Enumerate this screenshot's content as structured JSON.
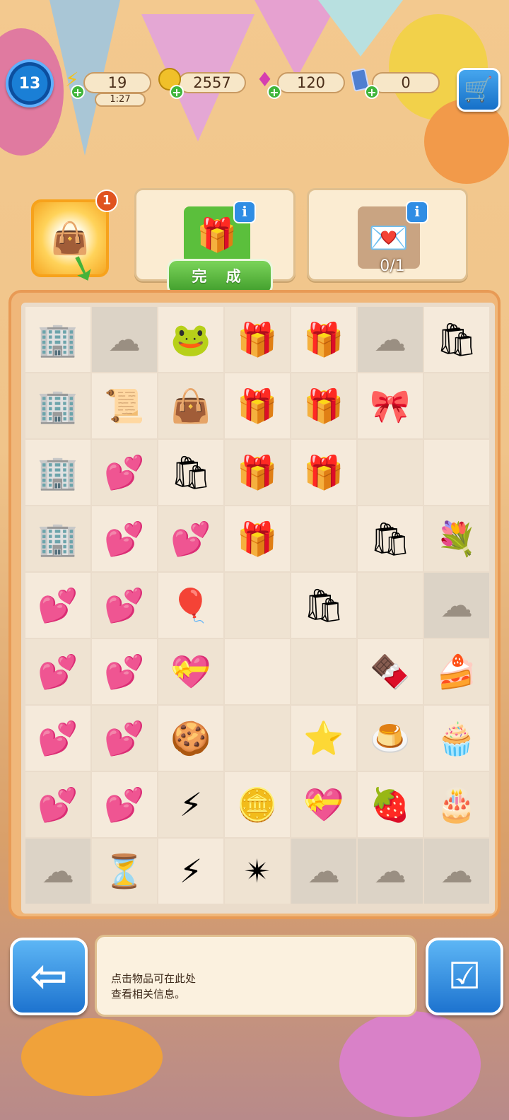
{
  "hud": {
    "level": "13",
    "energy": "19",
    "energy_timer": "1:27",
    "coins": "2557",
    "gems": "120",
    "cards": "0",
    "icons": {
      "energy": "lightning-icon",
      "coins": "coin-icon",
      "gems": "gem-icon",
      "cards": "card-icon",
      "shop": "shopping-cart-icon"
    },
    "add_symbol": "+"
  },
  "orders": {
    "reward_count": "1",
    "done_label": "完 成",
    "progress": "0/1",
    "info_symbol": "i"
  },
  "board": {
    "rows": [
      [
        "🏢",
        "☁",
        "🐸",
        "🎁",
        "🎁",
        "☁",
        "🛍"
      ],
      [
        "🏢",
        "📜",
        "👜",
        "🎁",
        "🎁",
        "🎀",
        ""
      ],
      [
        "🏢",
        "💕",
        "🛍",
        "🎁",
        "🎁",
        "",
        ""
      ],
      [
        "🏢",
        "💕",
        "💕",
        "🎁",
        "",
        "🛍",
        "💐"
      ],
      [
        "💕",
        "💕",
        "🎈",
        "",
        "🛍",
        "",
        "☁"
      ],
      [
        "💕",
        "💕",
        "💝",
        "",
        "",
        "🍫",
        "🍰"
      ],
      [
        "💕",
        "💕",
        "🍪",
        "",
        "⭐",
        "🍮",
        "🧁"
      ],
      [
        "💕",
        "💕",
        "⚡",
        "🪙",
        "💝",
        "🍓",
        "🎂"
      ],
      [
        "☁",
        "⏳",
        "⚡",
        "✴",
        "☁",
        "☁",
        "☁"
      ]
    ]
  },
  "bottom": {
    "info_line1": "点击物品可在此处",
    "info_line2": "查看相关信息。"
  },
  "colors": {
    "accent_blue": "#1d73cf",
    "accent_green": "#3f9c2a",
    "frame": "#e89a55"
  }
}
